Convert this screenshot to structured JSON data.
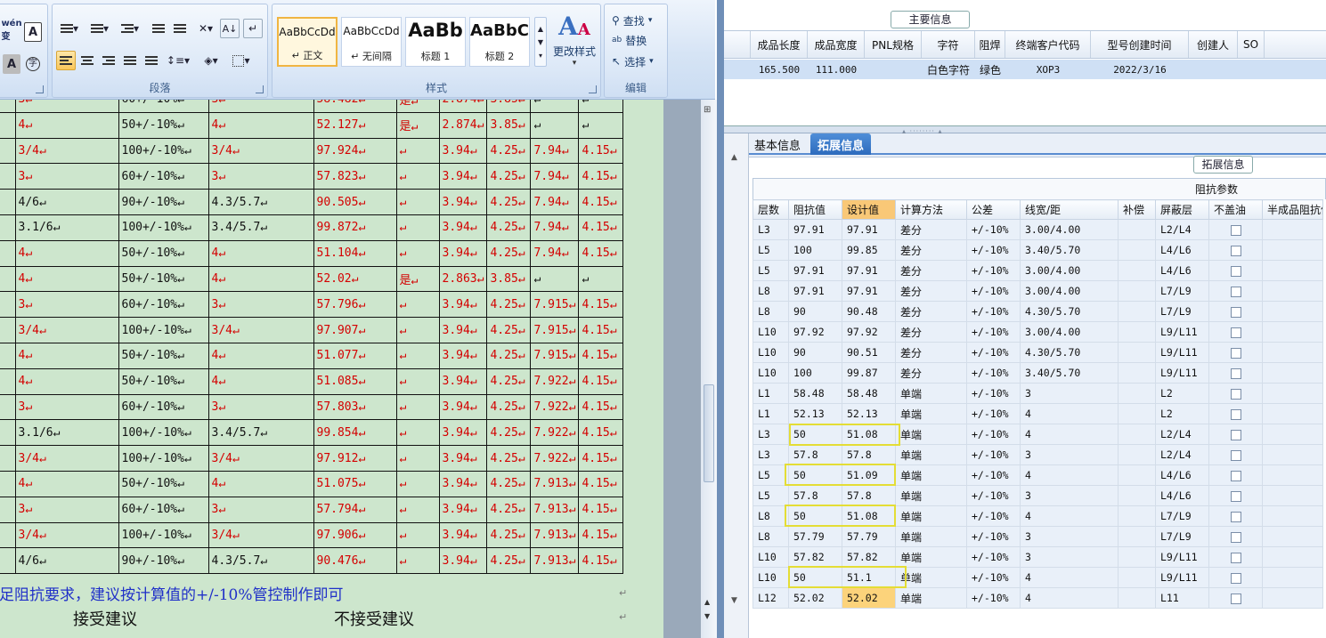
{
  "ribbon": {
    "paragraph_label": "段落",
    "styles_label": "样式",
    "editing_label": "编辑",
    "change_styles": "更改样式",
    "find": "查找",
    "replace": "替换",
    "select": "选择",
    "styles": [
      {
        "preview": "AaBbCcDd",
        "name": "↵ 正文"
      },
      {
        "preview": "AaBbCcDd",
        "name": "↵ 无间隔"
      },
      {
        "preview": "AaBb",
        "name": "标题 1"
      },
      {
        "preview": "AaBbC",
        "name": "标题 2"
      }
    ]
  },
  "doc": {
    "rows": [
      [
        "3↵",
        "60+/-10%↵",
        "3↵",
        "58.482↵",
        "是↵",
        "2.874↵",
        "3.85↵",
        "↵",
        "↵"
      ],
      [
        "4↵",
        "50+/-10%↵",
        "4↵",
        "52.127↵",
        "是↵",
        "2.874↵",
        "3.85↵",
        "↵",
        "↵"
      ],
      [
        "3/4↵",
        "100+/-10%↵",
        "3/4↵",
        "97.924↵",
        "↵",
        "3.94↵",
        "4.25↵",
        "7.94↵",
        "4.15↵"
      ],
      [
        "3↵",
        "60+/-10%↵",
        "3↵",
        "57.823↵",
        "↵",
        "3.94↵",
        "4.25↵",
        "7.94↵",
        "4.15↵"
      ],
      [
        "4/6↵",
        "90+/-10%↵",
        "4.3/5.7↵",
        "90.505↵",
        "↵",
        "3.94↵",
        "4.25↵",
        "7.94↵",
        "4.15↵"
      ],
      [
        "3.1/6↵",
        "100+/-10%↵",
        "3.4/5.7↵",
        "99.872↵",
        "↵",
        "3.94↵",
        "4.25↵",
        "7.94↵",
        "4.15↵"
      ],
      [
        "4↵",
        "50+/-10%↵",
        "4↵",
        "51.104↵",
        "↵",
        "3.94↵",
        "4.25↵",
        "7.94↵",
        "4.15↵"
      ],
      [
        "4↵",
        "50+/-10%↵",
        "4↵",
        "52.02↵",
        "是↵",
        "2.863↵",
        "3.85↵",
        "↵",
        "↵"
      ],
      [
        "3↵",
        "60+/-10%↵",
        "3↵",
        "57.796↵",
        "↵",
        "3.94↵",
        "4.25↵",
        "7.915↵",
        "4.15↵"
      ],
      [
        "3/4↵",
        "100+/-10%↵",
        "3/4↵",
        "97.907↵",
        "↵",
        "3.94↵",
        "4.25↵",
        "7.915↵",
        "4.15↵"
      ],
      [
        "4↵",
        "50+/-10%↵",
        "4↵",
        "51.077↵",
        "↵",
        "3.94↵",
        "4.25↵",
        "7.915↵",
        "4.15↵"
      ],
      [
        "4↵",
        "50+/-10%↵",
        "4↵",
        "51.085↵",
        "↵",
        "3.94↵",
        "4.25↵",
        "7.922↵",
        "4.15↵"
      ],
      [
        "3↵",
        "60+/-10%↵",
        "3↵",
        "57.803↵",
        "↵",
        "3.94↵",
        "4.25↵",
        "7.922↵",
        "4.15↵"
      ],
      [
        "3.1/6↵",
        "100+/-10%↵",
        "3.4/5.7↵",
        "99.854↵",
        "↵",
        "3.94↵",
        "4.25↵",
        "7.922↵",
        "4.15↵"
      ],
      [
        "3/4↵",
        "100+/-10%↵",
        "3/4↵",
        "97.912↵",
        "↵",
        "3.94↵",
        "4.25↵",
        "7.922↵",
        "4.15↵"
      ],
      [
        "4↵",
        "50+/-10%↵",
        "4↵",
        "51.075↵",
        "↵",
        "3.94↵",
        "4.25↵",
        "7.913↵",
        "4.15↵"
      ],
      [
        "3↵",
        "60+/-10%↵",
        "3↵",
        "57.794↵",
        "↵",
        "3.94↵",
        "4.25↵",
        "7.913↵",
        "4.15↵"
      ],
      [
        "3/4↵",
        "100+/-10%↵",
        "3/4↵",
        "97.906↵",
        "↵",
        "3.94↵",
        "4.25↵",
        "7.913↵",
        "4.15↵"
      ],
      [
        "4/6↵",
        "90+/-10%↵",
        "4.3/5.7↵",
        "90.476↵",
        "↵",
        "3.94↵",
        "4.25↵",
        "7.913↵",
        "4.15↵"
      ]
    ],
    "row_colors": [
      "red",
      "red",
      "red",
      "red",
      "blk",
      "blk",
      "red",
      "red",
      "red",
      "red",
      "red",
      "red",
      "red",
      "blk",
      "red",
      "red",
      "red",
      "red",
      "blk"
    ],
    "note": "足阻抗要求，建议按计算值的+/-10%管控制作即可",
    "accept": "接受建议",
    "reject": "不接受建议"
  },
  "main_info": {
    "legend": "主要信息",
    "headers": [
      "成品长度",
      "成品宽度",
      "PNL规格",
      "字符",
      "阻焊",
      "终端客户代码",
      "型号创建时间",
      "创建人",
      "SO"
    ],
    "row": [
      "165.500",
      "111.000",
      "",
      "白色字符",
      "绿色",
      "XOP3",
      "2022/3/16",
      "",
      ""
    ]
  },
  "tabs": [
    "基本信息",
    "拓展信息"
  ],
  "ext": {
    "legend": "拓展信息",
    "group_header": "阻抗参数",
    "headers": [
      "层数",
      "阻抗值",
      "设计值",
      "计算方法",
      "公差",
      "线宽/距",
      "补偿",
      "屏蔽层",
      "不盖油",
      "半成品阻抗值"
    ],
    "rows": [
      [
        "L3",
        "97.91",
        "97.91",
        "差分",
        "+/-10%",
        "3.00/4.00",
        "",
        "L2/L4"
      ],
      [
        "L5",
        "100",
        "99.85",
        "差分",
        "+/-10%",
        "3.40/5.70",
        "",
        "L4/L6"
      ],
      [
        "L5",
        "97.91",
        "97.91",
        "差分",
        "+/-10%",
        "3.00/4.00",
        "",
        "L4/L6"
      ],
      [
        "L8",
        "97.91",
        "97.91",
        "差分",
        "+/-10%",
        "3.00/4.00",
        "",
        "L7/L9"
      ],
      [
        "L8",
        "90",
        "90.48",
        "差分",
        "+/-10%",
        "4.30/5.70",
        "",
        "L7/L9"
      ],
      [
        "L10",
        "97.92",
        "97.92",
        "差分",
        "+/-10%",
        "3.00/4.00",
        "",
        "L9/L11"
      ],
      [
        "L10",
        "90",
        "90.51",
        "差分",
        "+/-10%",
        "4.30/5.70",
        "",
        "L9/L11"
      ],
      [
        "L10",
        "100",
        "99.87",
        "差分",
        "+/-10%",
        "3.40/5.70",
        "",
        "L9/L11"
      ],
      [
        "L1",
        "58.48",
        "58.48",
        "单端",
        "+/-10%",
        "3",
        "",
        "L2"
      ],
      [
        "L1",
        "52.13",
        "52.13",
        "单端",
        "+/-10%",
        "4",
        "",
        "L2"
      ],
      [
        "L3",
        "50",
        "51.08",
        "单端",
        "+/-10%",
        "4",
        "",
        "L2/L4"
      ],
      [
        "L3",
        "57.8",
        "57.8",
        "单端",
        "+/-10%",
        "3",
        "",
        "L2/L4"
      ],
      [
        "L5",
        "50",
        "51.09",
        "单端",
        "+/-10%",
        "4",
        "",
        "L4/L6"
      ],
      [
        "L5",
        "57.8",
        "57.8",
        "单端",
        "+/-10%",
        "3",
        "",
        "L4/L6"
      ],
      [
        "L8",
        "50",
        "51.08",
        "单端",
        "+/-10%",
        "4",
        "",
        "L7/L9"
      ],
      [
        "L8",
        "57.79",
        "57.79",
        "单端",
        "+/-10%",
        "3",
        "",
        "L7/L9"
      ],
      [
        "L10",
        "57.82",
        "57.82",
        "单端",
        "+/-10%",
        "3",
        "",
        "L9/L11"
      ],
      [
        "L10",
        "50",
        "51.1",
        "单端",
        "+/-10%",
        "4",
        "",
        "L9/L11"
      ],
      [
        "L12",
        "52.02",
        "52.02",
        "单端",
        "+/-10%",
        "4",
        "",
        "L11"
      ]
    ]
  }
}
